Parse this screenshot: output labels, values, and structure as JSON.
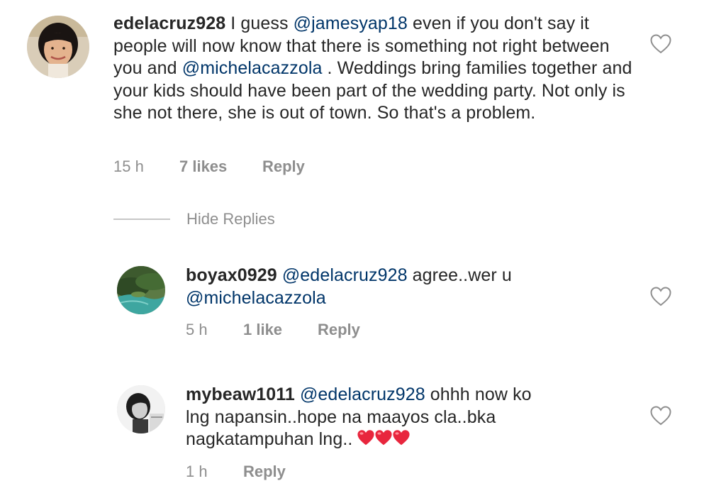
{
  "comments": [
    {
      "username": "edelacruz928",
      "segments": [
        {
          "text": " I guess "
        },
        {
          "text": "@jamesyap18",
          "mention": true
        },
        {
          "text": " even if you don't say it people will now know that there is something not right between you and "
        },
        {
          "text": "@michelacazzola",
          "mention": true
        },
        {
          "text": " . Weddings bring families together and your kids should have been part of the wedding party. Not only is she not there, she is out of town. So that's a problem."
        }
      ],
      "time": "15 h",
      "likes": "7 likes",
      "reply_label": "Reply"
    }
  ],
  "hide_replies_label": "Hide Replies",
  "replies": [
    {
      "username": "boyax0929",
      "segments": [
        {
          "text": " "
        },
        {
          "text": "@edelacruz928",
          "mention": true
        },
        {
          "text": " agree..wer u "
        },
        {
          "text": "@michelacazzola",
          "mention": true
        }
      ],
      "time": "5 h",
      "likes": "1 like",
      "reply_label": "Reply"
    },
    {
      "username": "mybeaw1011",
      "segments": [
        {
          "text": " "
        },
        {
          "text": "@edelacruz928",
          "mention": true
        },
        {
          "text": " ohhh now ko lng napansin..hope na maayos cla..bka nagkatampuhan lng.."
        }
      ],
      "emoji": "heart-emoji",
      "emoji_count": 3,
      "time": "1 h",
      "likes": "",
      "reply_label": "Reply"
    }
  ],
  "colors": {
    "text": "#262626",
    "mention": "#003569",
    "meta": "#8e8e8e",
    "divider": "#c7c7c7",
    "heart_emoji": "#e8263d"
  },
  "icons": {
    "like": "heart-outline-icon"
  }
}
